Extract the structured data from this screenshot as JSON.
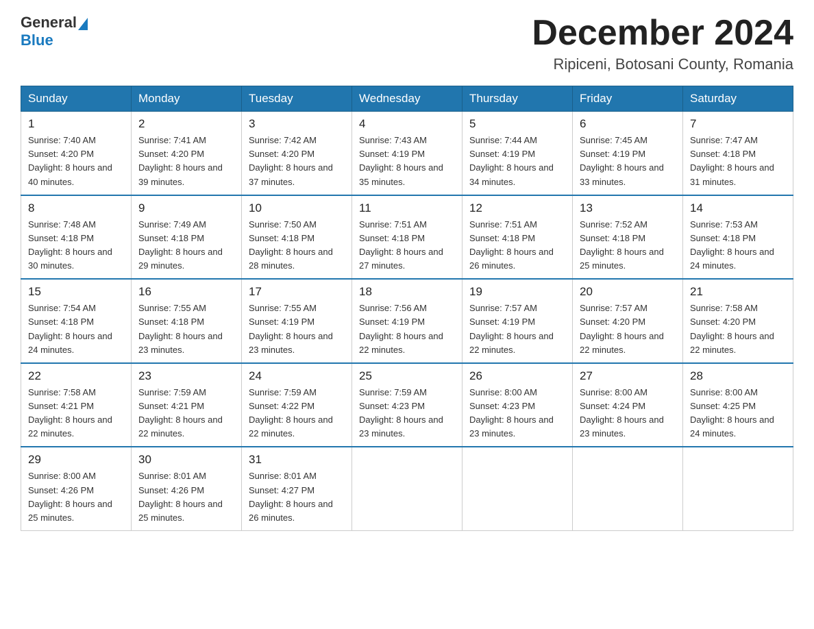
{
  "header": {
    "logo_general": "General",
    "logo_blue": "Blue",
    "month_title": "December 2024",
    "location": "Ripiceni, Botosani County, Romania"
  },
  "weekdays": [
    "Sunday",
    "Monday",
    "Tuesday",
    "Wednesday",
    "Thursday",
    "Friday",
    "Saturday"
  ],
  "weeks": [
    [
      {
        "day": "1",
        "sunrise": "7:40 AM",
        "sunset": "4:20 PM",
        "daylight": "8 hours and 40 minutes."
      },
      {
        "day": "2",
        "sunrise": "7:41 AM",
        "sunset": "4:20 PM",
        "daylight": "8 hours and 39 minutes."
      },
      {
        "day": "3",
        "sunrise": "7:42 AM",
        "sunset": "4:20 PM",
        "daylight": "8 hours and 37 minutes."
      },
      {
        "day": "4",
        "sunrise": "7:43 AM",
        "sunset": "4:19 PM",
        "daylight": "8 hours and 35 minutes."
      },
      {
        "day": "5",
        "sunrise": "7:44 AM",
        "sunset": "4:19 PM",
        "daylight": "8 hours and 34 minutes."
      },
      {
        "day": "6",
        "sunrise": "7:45 AM",
        "sunset": "4:19 PM",
        "daylight": "8 hours and 33 minutes."
      },
      {
        "day": "7",
        "sunrise": "7:47 AM",
        "sunset": "4:18 PM",
        "daylight": "8 hours and 31 minutes."
      }
    ],
    [
      {
        "day": "8",
        "sunrise": "7:48 AM",
        "sunset": "4:18 PM",
        "daylight": "8 hours and 30 minutes."
      },
      {
        "day": "9",
        "sunrise": "7:49 AM",
        "sunset": "4:18 PM",
        "daylight": "8 hours and 29 minutes."
      },
      {
        "day": "10",
        "sunrise": "7:50 AM",
        "sunset": "4:18 PM",
        "daylight": "8 hours and 28 minutes."
      },
      {
        "day": "11",
        "sunrise": "7:51 AM",
        "sunset": "4:18 PM",
        "daylight": "8 hours and 27 minutes."
      },
      {
        "day": "12",
        "sunrise": "7:51 AM",
        "sunset": "4:18 PM",
        "daylight": "8 hours and 26 minutes."
      },
      {
        "day": "13",
        "sunrise": "7:52 AM",
        "sunset": "4:18 PM",
        "daylight": "8 hours and 25 minutes."
      },
      {
        "day": "14",
        "sunrise": "7:53 AM",
        "sunset": "4:18 PM",
        "daylight": "8 hours and 24 minutes."
      }
    ],
    [
      {
        "day": "15",
        "sunrise": "7:54 AM",
        "sunset": "4:18 PM",
        "daylight": "8 hours and 24 minutes."
      },
      {
        "day": "16",
        "sunrise": "7:55 AM",
        "sunset": "4:18 PM",
        "daylight": "8 hours and 23 minutes."
      },
      {
        "day": "17",
        "sunrise": "7:55 AM",
        "sunset": "4:19 PM",
        "daylight": "8 hours and 23 minutes."
      },
      {
        "day": "18",
        "sunrise": "7:56 AM",
        "sunset": "4:19 PM",
        "daylight": "8 hours and 22 minutes."
      },
      {
        "day": "19",
        "sunrise": "7:57 AM",
        "sunset": "4:19 PM",
        "daylight": "8 hours and 22 minutes."
      },
      {
        "day": "20",
        "sunrise": "7:57 AM",
        "sunset": "4:20 PM",
        "daylight": "8 hours and 22 minutes."
      },
      {
        "day": "21",
        "sunrise": "7:58 AM",
        "sunset": "4:20 PM",
        "daylight": "8 hours and 22 minutes."
      }
    ],
    [
      {
        "day": "22",
        "sunrise": "7:58 AM",
        "sunset": "4:21 PM",
        "daylight": "8 hours and 22 minutes."
      },
      {
        "day": "23",
        "sunrise": "7:59 AM",
        "sunset": "4:21 PM",
        "daylight": "8 hours and 22 minutes."
      },
      {
        "day": "24",
        "sunrise": "7:59 AM",
        "sunset": "4:22 PM",
        "daylight": "8 hours and 22 minutes."
      },
      {
        "day": "25",
        "sunrise": "7:59 AM",
        "sunset": "4:23 PM",
        "daylight": "8 hours and 23 minutes."
      },
      {
        "day": "26",
        "sunrise": "8:00 AM",
        "sunset": "4:23 PM",
        "daylight": "8 hours and 23 minutes."
      },
      {
        "day": "27",
        "sunrise": "8:00 AM",
        "sunset": "4:24 PM",
        "daylight": "8 hours and 23 minutes."
      },
      {
        "day": "28",
        "sunrise": "8:00 AM",
        "sunset": "4:25 PM",
        "daylight": "8 hours and 24 minutes."
      }
    ],
    [
      {
        "day": "29",
        "sunrise": "8:00 AM",
        "sunset": "4:26 PM",
        "daylight": "8 hours and 25 minutes."
      },
      {
        "day": "30",
        "sunrise": "8:01 AM",
        "sunset": "4:26 PM",
        "daylight": "8 hours and 25 minutes."
      },
      {
        "day": "31",
        "sunrise": "8:01 AM",
        "sunset": "4:27 PM",
        "daylight": "8 hours and 26 minutes."
      },
      null,
      null,
      null,
      null
    ]
  ]
}
